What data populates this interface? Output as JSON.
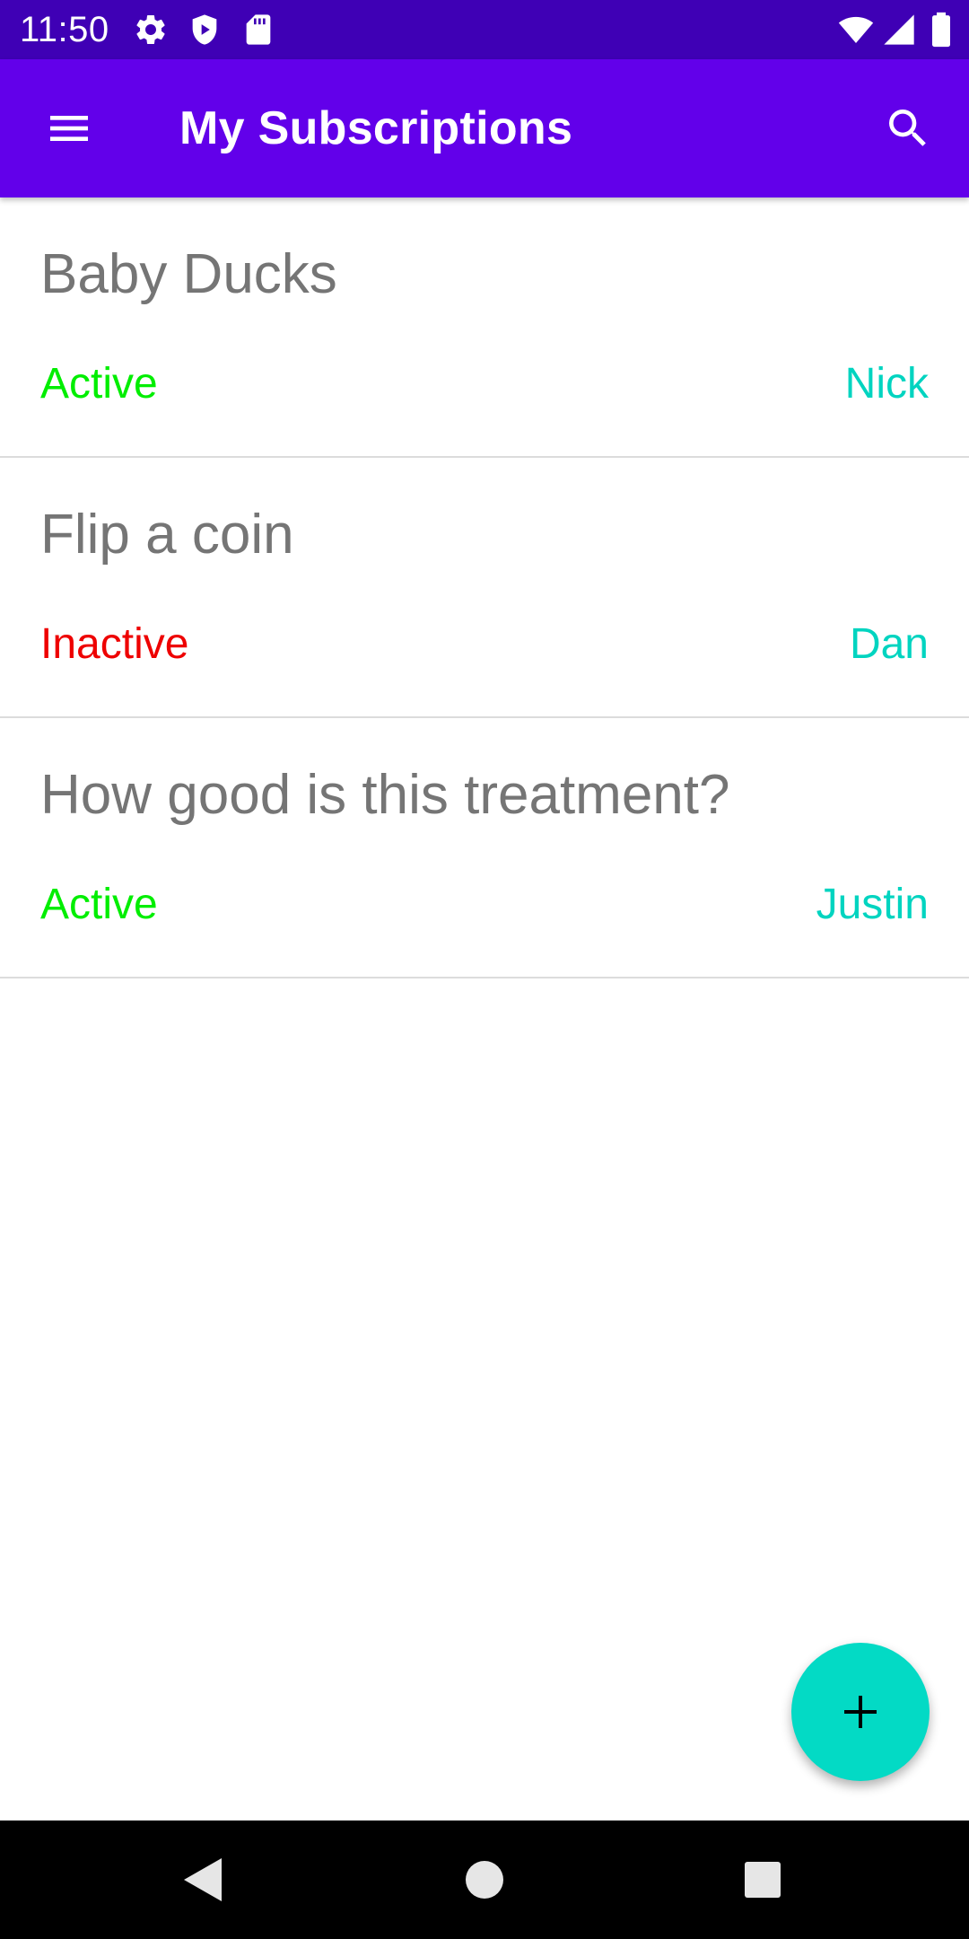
{
  "colors": {
    "status_bar_bg": "#3f00b5",
    "app_bar_bg": "#6200ea",
    "title_gray": "#757575",
    "active": "#00ee00",
    "inactive": "#ee0000",
    "owner": "#00d4c0",
    "fab": "#03dac5"
  },
  "status_bar": {
    "time": "11:50",
    "left_icons": [
      "settings-icon",
      "shield-icon",
      "sd-card-icon"
    ],
    "right_icons": [
      "wifi-icon",
      "cell-signal-icon",
      "battery-icon"
    ]
  },
  "app_bar": {
    "menu_icon": "menu-icon",
    "title": "My Subscriptions",
    "search_icon": "search-icon"
  },
  "subscriptions": [
    {
      "title": "Baby Ducks",
      "status": "Active",
      "owner": "Nick"
    },
    {
      "title": "Flip a coin",
      "status": "Inactive",
      "owner": "Dan"
    },
    {
      "title": "How good is this treatment?",
      "status": "Active",
      "owner": "Justin"
    }
  ],
  "fab": {
    "icon": "plus-icon"
  },
  "nav_bar": {
    "buttons": [
      "back-icon",
      "home-icon",
      "recents-icon"
    ]
  }
}
